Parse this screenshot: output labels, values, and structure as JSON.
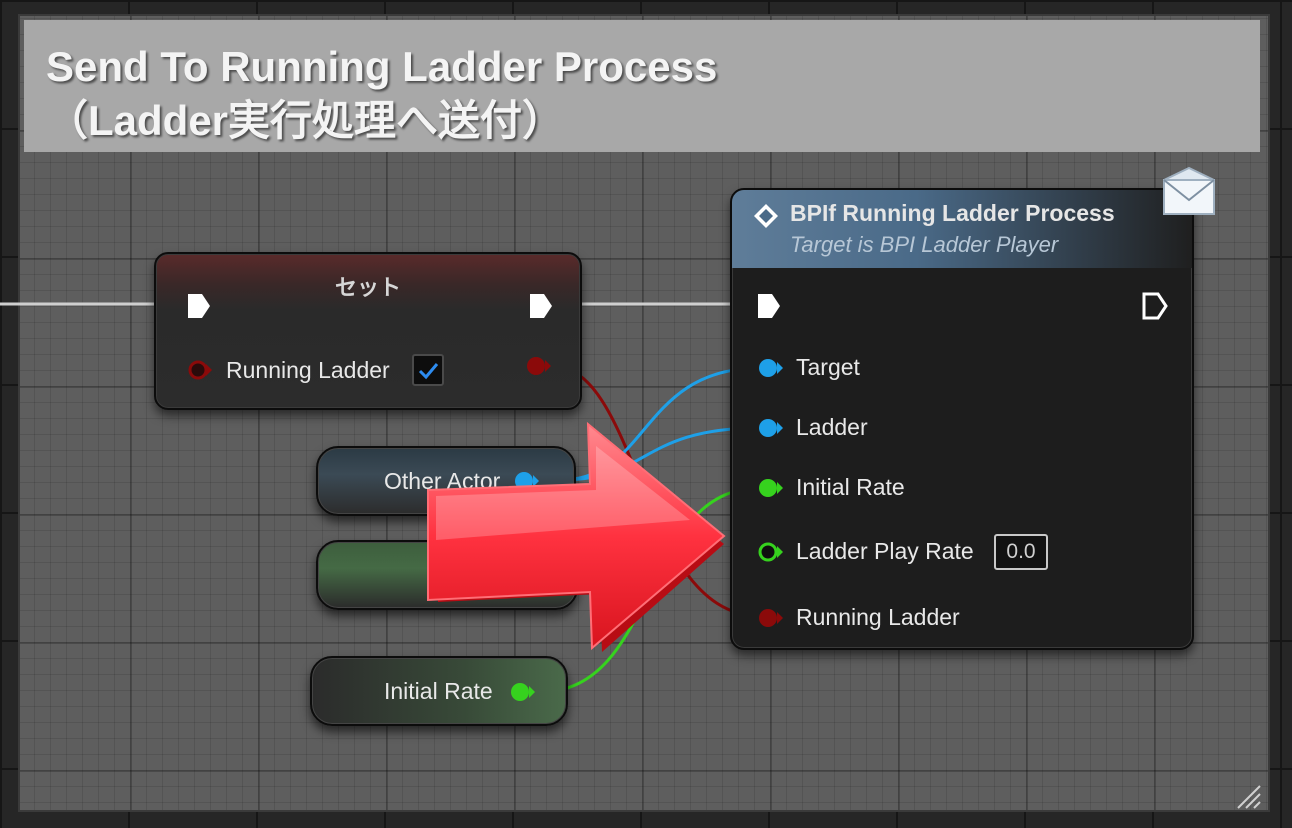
{
  "comment": {
    "title_line1": "Send To Running Ladder Process",
    "title_line2": "（Ladder実行処理へ送付）"
  },
  "set_node": {
    "title": "セット",
    "input_label": "Running Ladder",
    "checkbox_checked": true
  },
  "variable_nodes": {
    "other_actor": "Other Actor",
    "initial_rate": "Initial Rate"
  },
  "bpi_node": {
    "title": "BPIf Running Ladder Process",
    "subtitle": "Target is BPI Ladder Player",
    "pins": {
      "target": "Target",
      "ladder": "Ladder",
      "initial_rate": "Initial Rate",
      "ladder_play_rate": "Ladder Play Rate",
      "running_ladder": "Running Ladder"
    },
    "ladder_play_rate_value": "0.0"
  },
  "colors": {
    "object_pin": "#1ea0e8",
    "float_pin": "#36d21e",
    "bool_pin": "#8b0a0a",
    "exec_wire": "#d8d8d8",
    "arrow": "#ff2f3a"
  },
  "icons": {
    "interface_message": "envelope-icon",
    "function": "function-diamond-icon",
    "resize": "resize-grip-icon"
  }
}
